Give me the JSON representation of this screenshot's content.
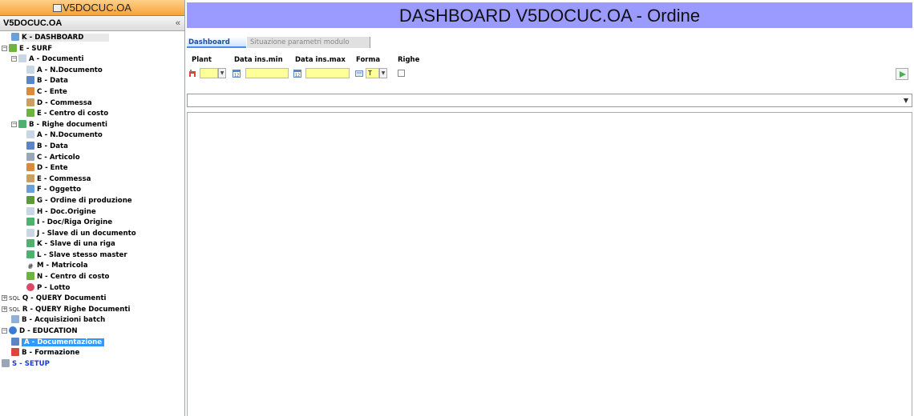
{
  "app_title": "V5DOCUC.OA",
  "panel": {
    "title": "V5DOCUC.OA",
    "collapse": "«"
  },
  "tree": [
    {
      "label": "K - DASHBOARD",
      "level": 1,
      "icon": "dashboard-icon",
      "color": "#6a9fd8"
    },
    {
      "label": "E - SURF",
      "level": 0,
      "icon": "surf-icon",
      "color": "#6db33f",
      "exp": "⊟"
    },
    {
      "label": "A - Documenti",
      "level": 1,
      "icon": "document-icon",
      "color": "#c9d6e6",
      "exp": "⊟"
    },
    {
      "label": "A - N.Documento",
      "level": 2,
      "icon": "document-icon",
      "color": "#c9d6e6"
    },
    {
      "label": "B - Data",
      "level": 2,
      "icon": "calendar-icon",
      "color": "#5b86c4"
    },
    {
      "label": "C - Ente",
      "level": 2,
      "icon": "person-icon",
      "color": "#d98a3a"
    },
    {
      "label": "D - Commessa",
      "level": 2,
      "icon": "commessa-icon",
      "color": "#c9a060"
    },
    {
      "label": "E - Centro di costo",
      "level": 2,
      "icon": "dollar-icon",
      "color": "#6db33f"
    },
    {
      "label": "B - Righe documenti",
      "level": 1,
      "icon": "rows-icon",
      "color": "#4fb070",
      "exp": "⊟"
    },
    {
      "label": "A - N.Documento",
      "level": 2,
      "icon": "document-icon",
      "color": "#c9d6e6"
    },
    {
      "label": "B - Data",
      "level": 2,
      "icon": "calendar-icon",
      "color": "#5b86c4"
    },
    {
      "label": "C - Articolo",
      "level": 2,
      "icon": "wrench-icon",
      "color": "#9aa6b8"
    },
    {
      "label": "D - Ente",
      "level": 2,
      "icon": "person-icon",
      "color": "#d98a3a"
    },
    {
      "label": "E - Commessa",
      "level": 2,
      "icon": "commessa-icon",
      "color": "#c9a060"
    },
    {
      "label": "F - Oggetto",
      "level": 2,
      "icon": "object-icon",
      "color": "#6a9fd8"
    },
    {
      "label": "G - Ordine di produzione",
      "level": 2,
      "icon": "production-icon",
      "color": "#5a9a3a"
    },
    {
      "label": "H - Doc.Origine",
      "level": 2,
      "icon": "document-icon",
      "color": "#c9d6e6"
    },
    {
      "label": "I - Doc/Riga Origine",
      "level": 2,
      "icon": "rows-icon",
      "color": "#4fb070"
    },
    {
      "label": "J - Slave di un documento",
      "level": 2,
      "icon": "document-icon",
      "color": "#c9d6e6"
    },
    {
      "label": "K - Slave di una riga",
      "level": 2,
      "icon": "rows-icon",
      "color": "#4fb070"
    },
    {
      "label": "L - Slave stesso master",
      "level": 2,
      "icon": "rows-icon",
      "color": "#4fb070"
    },
    {
      "label": "M - Matricola",
      "level": 2,
      "icon": "hash-icon",
      "color": "#ffffff"
    },
    {
      "label": "N - Centro di costo",
      "level": 2,
      "icon": "dollar-icon",
      "color": "#6db33f"
    },
    {
      "label": "P - Lotto",
      "level": 2,
      "icon": "lot-icon",
      "color": "#d94a6a"
    },
    {
      "label": "Q - QUERY Documenti",
      "level": 0,
      "icon": "sql-icon",
      "sql": "SQL",
      "exp": "⊞"
    },
    {
      "label": "R - QUERY Righe Documenti",
      "level": 0,
      "icon": "sql-icon",
      "sql": "SQL",
      "exp": "⊞"
    },
    {
      "label": "B - Acquisizioni batch",
      "level": 1,
      "icon": "batch-icon",
      "color": "#8fb0d8"
    },
    {
      "label": "D - EDUCATION",
      "level": 0,
      "icon": "info-icon",
      "color": "#3b7bd6",
      "exp": "⊟"
    },
    {
      "label": "A - Documentazione",
      "level": 1,
      "icon": "manual-icon",
      "color": "#5b86c4",
      "selected": true
    },
    {
      "label": "B - Formazione",
      "level": 1,
      "icon": "training-icon",
      "color": "#d9463a"
    },
    {
      "label": "S - SETUP",
      "level": 0,
      "icon": "setup-icon",
      "color": "#9aa6b8",
      "setup": true
    }
  ],
  "banner": "DASHBOARD V5DOCUC.OA - Ordine",
  "tabs": {
    "dashboard": "Dashboard",
    "situazione": "Situazione parametri modulo"
  },
  "filters": {
    "plant_label": "Plant",
    "data_min_label": "Data ins.min",
    "data_max_label": "Data ins.max",
    "forma_label": "Forma",
    "righe_label": "Righe",
    "forma_value": "T"
  },
  "selector": {
    "caret": "▼"
  },
  "dropdown_caret": "▼"
}
